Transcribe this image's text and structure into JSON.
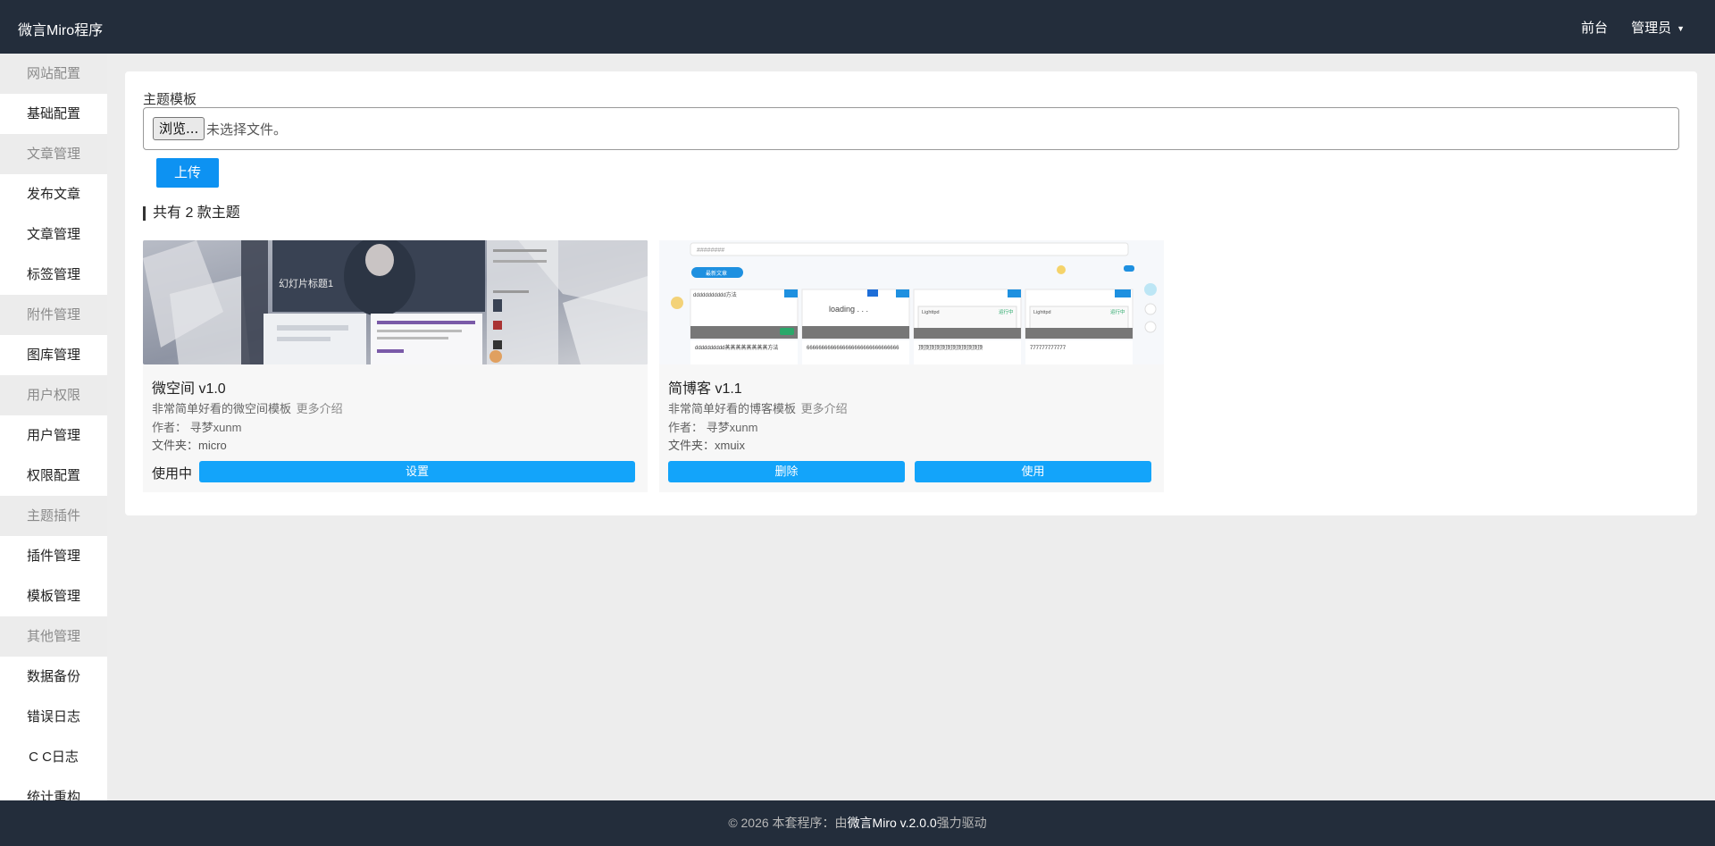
{
  "header": {
    "brand": "微言Miro程序",
    "front_link": "前台",
    "admin_menu": "管理员"
  },
  "sidebar": [
    {
      "type": "group",
      "label": "网站配置"
    },
    {
      "type": "item",
      "label": "基础配置"
    },
    {
      "type": "group",
      "label": "文章管理"
    },
    {
      "type": "item",
      "label": "发布文章"
    },
    {
      "type": "item",
      "label": "文章管理"
    },
    {
      "type": "item",
      "label": "标签管理"
    },
    {
      "type": "group",
      "label": "附件管理"
    },
    {
      "type": "item",
      "label": "图库管理"
    },
    {
      "type": "group",
      "label": "用户权限"
    },
    {
      "type": "item",
      "label": "用户管理"
    },
    {
      "type": "item",
      "label": "权限配置"
    },
    {
      "type": "group",
      "label": "主题插件"
    },
    {
      "type": "item",
      "label": "插件管理"
    },
    {
      "type": "item",
      "label": "模板管理"
    },
    {
      "type": "group",
      "label": "其他管理"
    },
    {
      "type": "item",
      "label": "数据备份"
    },
    {
      "type": "item",
      "label": "错误日志"
    },
    {
      "type": "item",
      "label": "C C日志"
    },
    {
      "type": "item",
      "label": "统计重构"
    }
  ],
  "upload": {
    "label": "主题模板",
    "browse_button": "浏览...",
    "file_status": "未选择文件。",
    "upload_button": "上传"
  },
  "themes_count_title": "共有 2 款主题",
  "themes": [
    {
      "name": "微空间 v1.0",
      "desc": "非常简单好看的微空间模板",
      "more": "更多介绍",
      "author": "作者：  寻梦xunm",
      "folder": "文件夹：micro",
      "status": "使用中",
      "settings_button": "设置",
      "thumb_caption": "幻灯片标题1"
    },
    {
      "name": "简博客 v1.1",
      "desc": "非常简单好看的博客模板",
      "more": "更多介绍",
      "author": "作者：  寻梦xunm",
      "folder": "文件夹：xmuix",
      "delete_button": "删除",
      "use_button": "使用",
      "thumb_texts": {
        "search": "########",
        "button": "最新文章",
        "title1": "ddddddddddd方法",
        "loading": "loading . . .",
        "c3_title": "Lighttpd",
        "c3_status": "运行中",
        "c4_title": "Lighttpd",
        "c4_status": "运行中",
        "row1": "dddddddddd蒸蒸蒸蒸蒸蒸蒸蒸方法",
        "row2": "6666666666666666666666666666666",
        "row3": "顶顶顶顶顶顶顶顶顶顶顶顶",
        "row4": "777777777777"
      }
    }
  ],
  "footer": {
    "prefix": "© 2026 本套程序：由",
    "product": "微言Miro v.2.0.0",
    "suffix": "强力驱动"
  }
}
